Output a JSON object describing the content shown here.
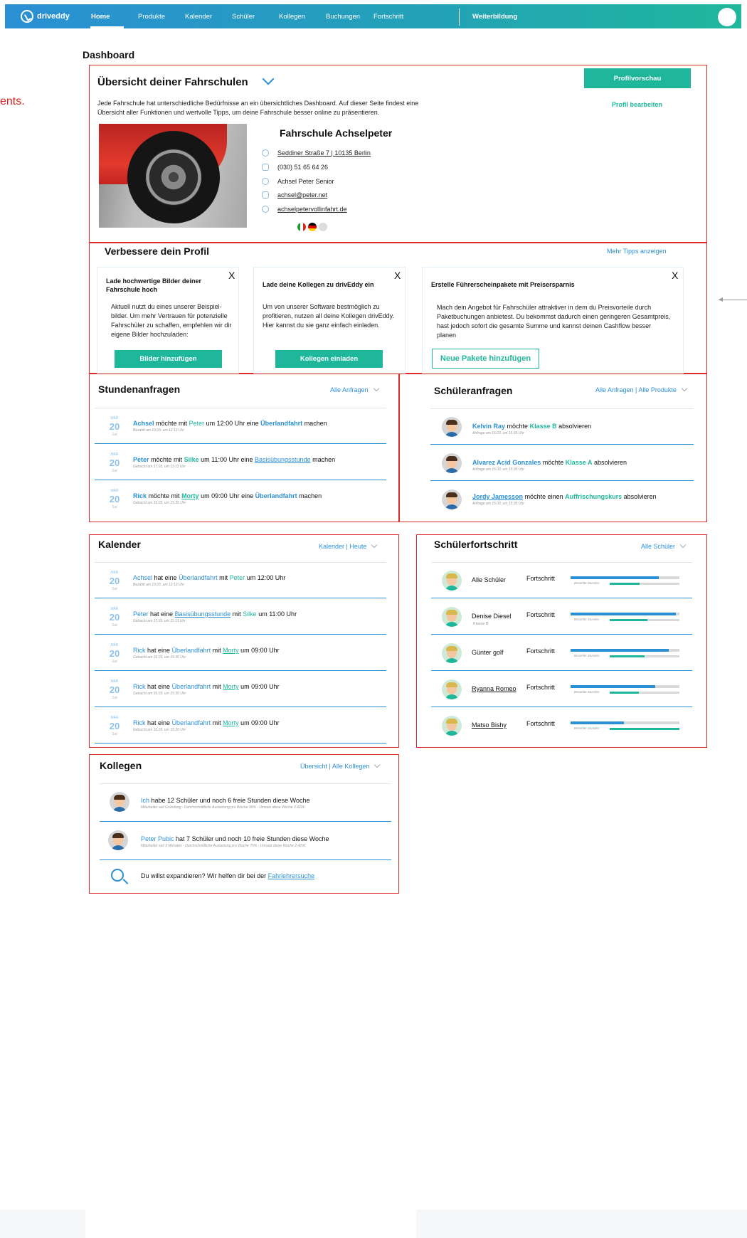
{
  "nav": {
    "logo": "driveddy",
    "items": [
      "Home",
      "Produkte",
      "Kalender",
      "Schüler",
      "Kollegen",
      "Buchungen",
      "Fortschritt"
    ],
    "extra": "Weiterbildung"
  },
  "page_title": "Dashboard",
  "side_note": "ents.",
  "overview": {
    "title": "Übersicht deiner Fahrschulen",
    "description": "Jede Fahrschule hat unterschiedliche Bedürfnisse an ein übersichtliches Dashboard. Auf dieser Seite findest eine Übersicht aller Funktionen und wertvolle Tipps, um deine Fahrschule besser online zu präsentieren.",
    "preview_button": "Profilvorschau",
    "edit_link": "Profil bearbeiten",
    "school_name": "Fahrschule Achselpeter",
    "address": "Seddiner Straße 7 | 10135 Berlin",
    "phone": "(030) 51 65 64 26",
    "owner": "Achsel Peter Senior",
    "email": "achsel@peter.net",
    "website": "achselpetervollinfahrt.de",
    "flag_colors": [
      "#1f9a3b",
      "#000000",
      "#dddddd"
    ]
  },
  "improve": {
    "title": "Verbessere dein Profil",
    "more_link": "Mehr Tipps anzeigen",
    "cards": [
      {
        "heading": "Lade hochwertige Bilder deiner Fahrschule hoch",
        "text": "Aktuell nutzt du eines unserer Beispiel-bilder. Um mehr Vertrauen für potenzielle Fahrschüler zu schaffen, empfehlen wir dir eigene Bilder hochzuladen:",
        "button": "Bilder hinzufügen",
        "close": "X"
      },
      {
        "heading": "Lade deine Kollegen zu drivEddy ein",
        "text": "Um von unserer Software bestmöglich zu profitieren, nutzen all deine Kollegen drivEddy. Hier kannst du sie ganz einfach einladen.",
        "button": "Kollegen einladen",
        "close": "X"
      },
      {
        "heading": "Erstelle Führerscheinpakete mit Preisersparnis",
        "text": "Mach dein Angebot für Fahrschüler attraktiver in dem du Preisvorteile durch Paketbuchungen anbietest. Du bekommst dadurch einen geringeren Gesamtpreis, hast jedoch sofort die gesamte Summe und kannst deinen Cashflow besser planen",
        "button": "Neue Pakete hinzufügen",
        "close": "X"
      }
    ]
  },
  "lesson_requests": {
    "title": "Stundenanfragen",
    "link": "Alle Anfragen",
    "rows": [
      {
        "month": "MÄR",
        "day": "20",
        "weekday": "Sat",
        "who": "Achsel",
        "verb": "möchte mit",
        "with": "Peter",
        "time": "um 12:00 Uhr eine",
        "type": "Überlandfahrt",
        "end": "machen",
        "sub": "Bezahlt am 19.03. um 12:13 Uhr"
      },
      {
        "month": "MÄR",
        "day": "20",
        "weekday": "Sat",
        "who": "Peter",
        "verb": "möchte mit",
        "with": "Silke",
        "time": "um 11:00 Uhr eine",
        "type": "Basisübungsstunde",
        "end": "machen",
        "sub": "Gebucht am 17.03. um 11:13 Uhr"
      },
      {
        "month": "MÄR",
        "day": "20",
        "weekday": "Sat",
        "who": "Rick",
        "verb": "möchte mit",
        "with": "Morty",
        "time": "um 09:00 Uhr eine",
        "type": "Überlandfahrt",
        "end": "machen",
        "sub": "Gebucht am 16.03. um 15:35 Uhr"
      }
    ]
  },
  "student_requests": {
    "title": "Schüleranfragen",
    "link": "Alle Anfragen | Alle Produkte",
    "rows": [
      {
        "name": "Kelvin Ray",
        "verb": "möchte",
        "target": "Klasse B",
        "end": "absolvieren",
        "sub": "Anfrage am 16.03. um 15:35 Uhr"
      },
      {
        "name": "Alvarez Acid Gonzales",
        "verb": "möchte",
        "target": "Klasse A",
        "end": "absolvieren",
        "sub": "Anfrage am 16.03. um 15:35 Uhr"
      },
      {
        "name": "Jordy Jamesson",
        "verb": "möchte einen",
        "target": "Auffrischungskurs",
        "end": "absolvieren",
        "sub": "Anfrage am 16.03. um 15:35 Uhr"
      }
    ]
  },
  "calendar": {
    "title": "Kalender",
    "link": "Kalender | Heute",
    "rows": [
      {
        "month": "MÄR",
        "day": "20",
        "weekday": "Sat",
        "who": "Achsel",
        "verb": "hat eine",
        "type": "Überlandfahrt",
        "mid": "mit",
        "with": "Peter",
        "time": "um 12:00 Uhr",
        "sub": "Bezahlt am 19.03. um 12:13 Uhr"
      },
      {
        "month": "MÄR",
        "day": "20",
        "weekday": "Sat",
        "who": "Peter",
        "verb": "hat eine",
        "type": "Basisübungsstunde",
        "mid": "mit",
        "with": "Silke",
        "time": "um 11:00 Uhr",
        "sub": "Gebucht am 17.03. um 11:13 Uhr"
      },
      {
        "month": "MÄR",
        "day": "20",
        "weekday": "Sat",
        "who": "Rick",
        "verb": "hat eine",
        "type": "Überlandfahrt",
        "mid": "mit",
        "with": "Morty",
        "time": "um 09:00 Uhr",
        "sub": "Gebucht am 16.03. um 15:35 Uhr"
      },
      {
        "month": "MÄR",
        "day": "20",
        "weekday": "Sat",
        "who": "Rick",
        "verb": "hat eine",
        "type": "Überlandfahrt",
        "mid": "mit",
        "with": "Morty",
        "time": "um 09:00 Uhr",
        "sub": "Gebucht am 16.03. um 15:35 Uhr"
      },
      {
        "month": "MÄR",
        "day": "20",
        "weekday": "Sat",
        "who": "Rick",
        "verb": "hat eine",
        "type": "Überlandfahrt",
        "mid": "mit",
        "with": "Morty",
        "time": "um 09:00 Uhr",
        "sub": "Gebucht am 16.03. um 15:35 Uhr"
      }
    ]
  },
  "progress": {
    "title": "Schülerfortschritt",
    "link": "Alle Schüler",
    "label": "Fortschritt",
    "note": "Bezahlte Stunden",
    "rows": [
      {
        "name": "Alle Schüler",
        "sub": "",
        "progress": 0.81,
        "paid": 0.43
      },
      {
        "name": "Denise Diesel",
        "sub": "Klasse B",
        "progress": 0.97,
        "paid": 0.54
      },
      {
        "name": "Günter golf",
        "sub": "",
        "progress": 0.9,
        "paid": 0.5
      },
      {
        "name": "Ryanna Romeo",
        "sub": "",
        "progress": 0.78,
        "paid": 0.42
      },
      {
        "name": "Matso Bishy",
        "sub": "",
        "progress": 0.49,
        "paid": 1.0
      }
    ]
  },
  "colleagues": {
    "title": "Kollegen",
    "link": "Übersicht | Alle Kollegen",
    "rows": [
      {
        "name": "Ich",
        "text": "habe 12 Schüler und noch 6 freie Stunden diese Woche",
        "sub": "Mitarbeiter seit Gründung - Durchschnittliche Auslastung pro Woche 90% - Umsatz diese Woche 3.423€"
      },
      {
        "name": "Peter Pubic",
        "text": "hat 7 Schüler und noch 10 freie Stunden diese Woche",
        "sub": "Mitarbeiter seit 3 Monaten - Durchschnittliche Auslastung pro Woche 75% - Umsatz diese Woche 2.423€"
      }
    ],
    "expand_text": "Du willst expandieren? Wir helfen dir bei der",
    "expand_link": "Fahrlehrersuche"
  }
}
